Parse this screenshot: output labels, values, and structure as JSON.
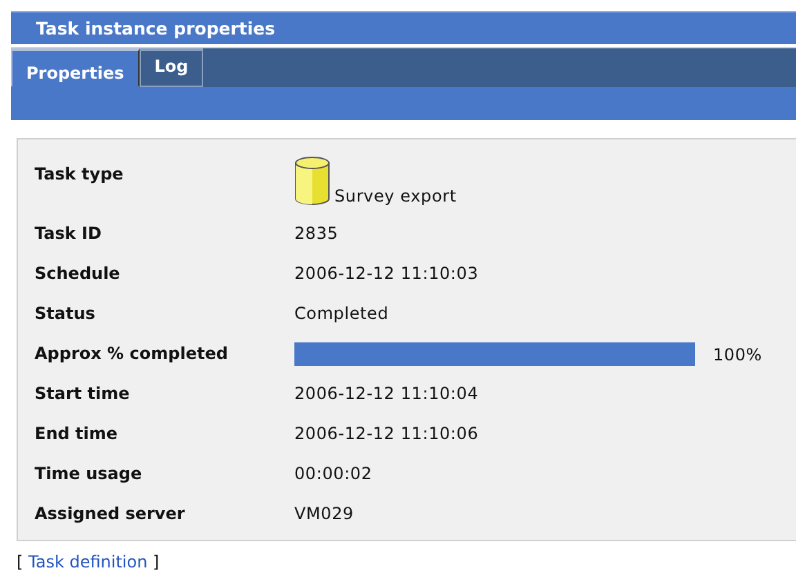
{
  "window": {
    "title": "Task instance properties"
  },
  "tabs": [
    {
      "label": "Properties",
      "selected": true
    },
    {
      "label": "Log",
      "selected": false
    }
  ],
  "properties": [
    {
      "kind": "icon_text",
      "label": "Task type",
      "value": "Survey export"
    },
    {
      "kind": "text",
      "label": "Task ID",
      "value": "2835"
    },
    {
      "kind": "text",
      "label": "Schedule",
      "value": "2006-12-12 11:10:03"
    },
    {
      "kind": "text",
      "label": "Status",
      "value": "Completed"
    },
    {
      "kind": "progress",
      "label": "Approx % completed",
      "level": 1,
      "value": "100%"
    },
    {
      "kind": "text",
      "label": "Start time",
      "value": "2006-12-12 11:10:04"
    },
    {
      "kind": "text",
      "label": "End time",
      "value": "2006-12-12 11:10:06"
    },
    {
      "kind": "text",
      "label": "Time usage",
      "value": "00:00:02"
    },
    {
      "kind": "text",
      "label": "Assigned server",
      "value": "VM029"
    }
  ],
  "footer": {
    "open": "[",
    "link": "Task definition",
    "close": "]"
  }
}
